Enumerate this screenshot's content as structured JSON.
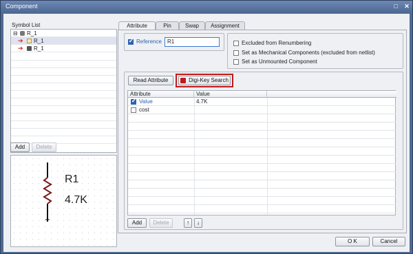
{
  "window": {
    "title": "Component",
    "maximize_icon": "maximize-icon",
    "close_icon": "close-icon"
  },
  "symbol_list": {
    "title": "Symbol List",
    "items": [
      {
        "label": "R_1",
        "expander": "⊟",
        "icon": "component-icon"
      },
      {
        "label": "R_1",
        "icon": "symbol-icon"
      },
      {
        "label": "R_1",
        "icon": "symbol-icon"
      }
    ],
    "add_label": "Add",
    "delete_label": "Delete"
  },
  "preview": {
    "ref": "R1",
    "value": "4.7K"
  },
  "tabs": [
    "Attribute",
    "Pin",
    "Swap",
    "Assignment"
  ],
  "attribute": {
    "reference_label": "Reference",
    "reference_value": "R1",
    "options": [
      "Excluded from Renumbering",
      "Set as Mechanical Components (excluded from netlist)",
      "Set as Unmounted Component"
    ],
    "read_attribute_label": "Read Attribute",
    "digikey_label": "Digi-Key Search",
    "table": {
      "headers": [
        "Attribute",
        "Value"
      ],
      "rows": [
        {
          "attribute": "Value",
          "value": "4.7K",
          "checked": true
        },
        {
          "attribute": "cost",
          "value": "",
          "checked": false
        }
      ]
    },
    "add_label": "Add",
    "delete_label": "Delete",
    "up_icon": "↑",
    "down_icon": "↓"
  },
  "footer": {
    "ok_label": "O K",
    "cancel_label": "Cancel"
  }
}
